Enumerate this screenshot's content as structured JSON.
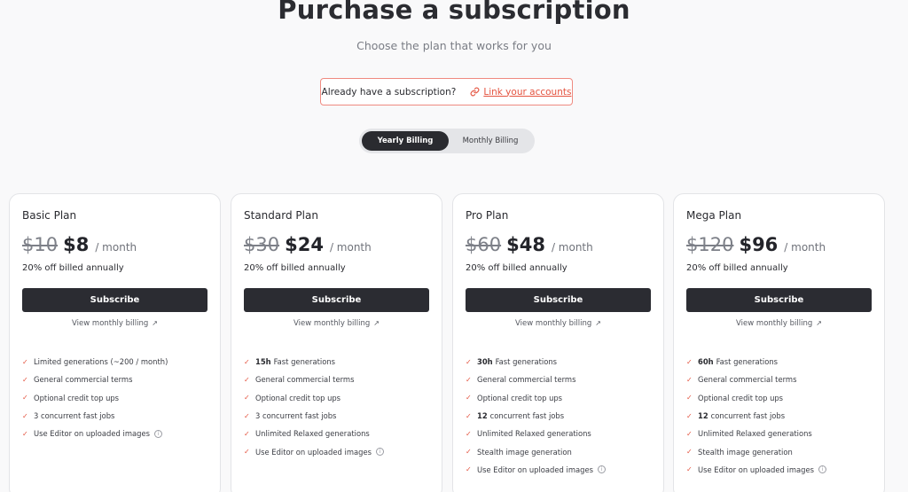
{
  "header": {
    "title": "Purchase a subscription",
    "subtitle": "Choose the plan that works for you"
  },
  "link_box": {
    "question": "Already have a subscription?",
    "link_label": "Link your accounts"
  },
  "billing_toggle": {
    "options": [
      "Yearly Billing",
      "Monthly Billing"
    ],
    "selected": "Yearly Billing"
  },
  "colors": {
    "accent": "#e4533f",
    "button": "#2b2c32"
  },
  "plans": [
    {
      "name": "Basic Plan",
      "old_price": "$10",
      "price": "$8",
      "period": "/ month",
      "discount": "20% off billed annually",
      "button": "Subscribe",
      "monthly_link": "View monthly billing",
      "features": [
        {
          "bold": "",
          "text": "Limited generations (~200 / month)",
          "info": false
        },
        {
          "bold": "",
          "text": "General commercial terms",
          "info": false
        },
        {
          "bold": "",
          "text": "Optional credit top ups",
          "info": false
        },
        {
          "bold": "",
          "text": "3 concurrent fast jobs",
          "info": false
        },
        {
          "bold": "",
          "text": "Use Editor on uploaded images",
          "info": true
        }
      ]
    },
    {
      "name": "Standard Plan",
      "old_price": "$30",
      "price": "$24",
      "period": "/ month",
      "discount": "20% off billed annually",
      "button": "Subscribe",
      "monthly_link": "View monthly billing",
      "features": [
        {
          "bold": "15h",
          "text": "Fast generations",
          "info": false
        },
        {
          "bold": "",
          "text": "General commercial terms",
          "info": false
        },
        {
          "bold": "",
          "text": "Optional credit top ups",
          "info": false
        },
        {
          "bold": "",
          "text": "3 concurrent fast jobs",
          "info": false
        },
        {
          "bold": "",
          "text": "Unlimited Relaxed generations",
          "info": false
        },
        {
          "bold": "",
          "text": "Use Editor on uploaded images",
          "info": true
        }
      ]
    },
    {
      "name": "Pro Plan",
      "old_price": "$60",
      "price": "$48",
      "period": "/ month",
      "discount": "20% off billed annually",
      "button": "Subscribe",
      "monthly_link": "View monthly billing",
      "features": [
        {
          "bold": "30h",
          "text": "Fast generations",
          "info": false
        },
        {
          "bold": "",
          "text": "General commercial terms",
          "info": false
        },
        {
          "bold": "",
          "text": "Optional credit top ups",
          "info": false
        },
        {
          "bold": "12",
          "text": "concurrent fast jobs",
          "info": false
        },
        {
          "bold": "",
          "text": "Unlimited Relaxed generations",
          "info": false
        },
        {
          "bold": "",
          "text": "Stealth image generation",
          "info": false
        },
        {
          "bold": "",
          "text": "Use Editor on uploaded images",
          "info": true
        }
      ]
    },
    {
      "name": "Mega Plan",
      "old_price": "$120",
      "price": "$96",
      "period": "/ month",
      "discount": "20% off billed annually",
      "button": "Subscribe",
      "monthly_link": "View monthly billing",
      "features": [
        {
          "bold": "60h",
          "text": "Fast generations",
          "info": false
        },
        {
          "bold": "",
          "text": "General commercial terms",
          "info": false
        },
        {
          "bold": "",
          "text": "Optional credit top ups",
          "info": false
        },
        {
          "bold": "12",
          "text": "concurrent fast jobs",
          "info": false
        },
        {
          "bold": "",
          "text": "Unlimited Relaxed generations",
          "info": false
        },
        {
          "bold": "",
          "text": "Stealth image generation",
          "info": false
        },
        {
          "bold": "",
          "text": "Use Editor on uploaded images",
          "info": true
        }
      ]
    }
  ]
}
